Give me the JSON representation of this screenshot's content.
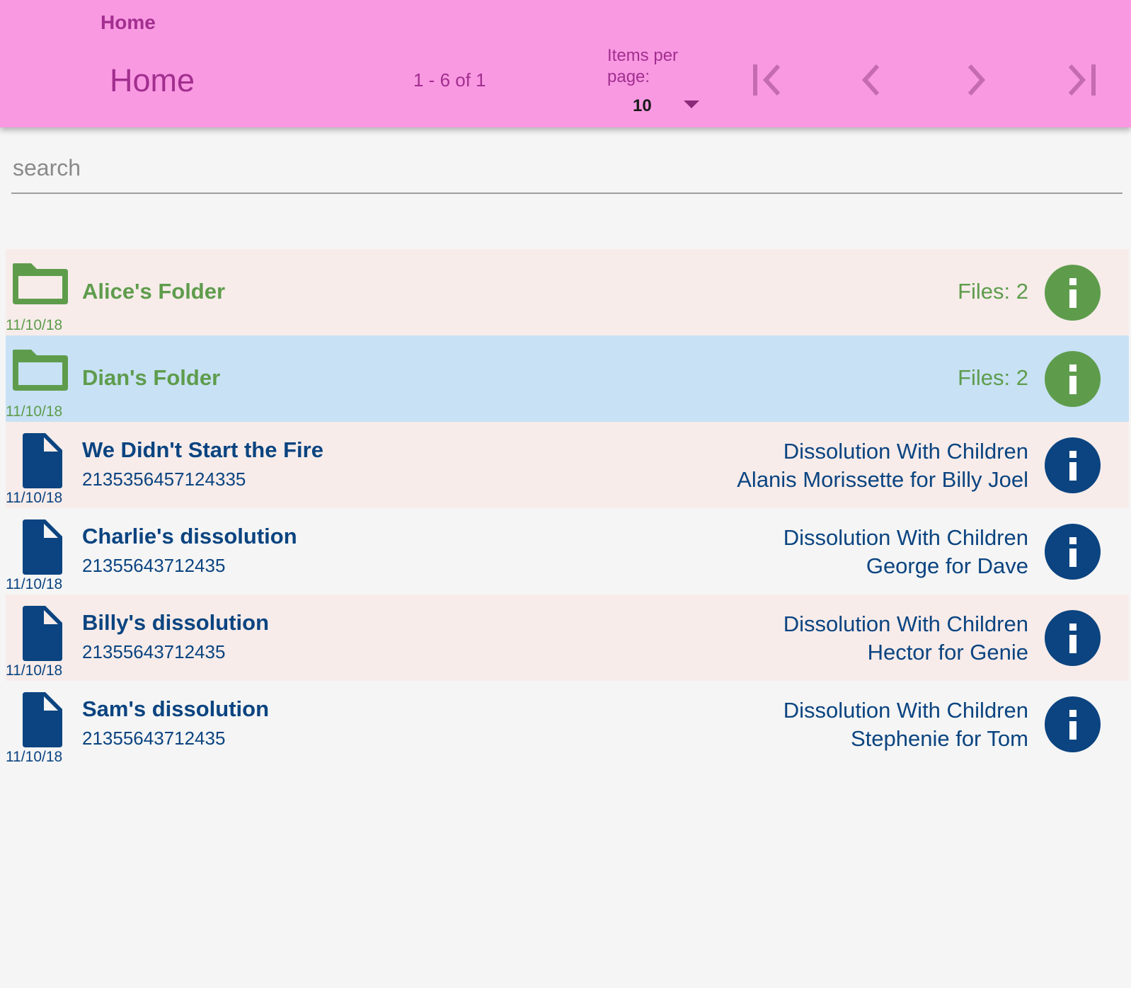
{
  "toolbar": {
    "breadcrumb": "Home",
    "title": "Home",
    "range_label": "1 - 6 of 1",
    "items_per_page_label": "Items per page:",
    "items_per_page_value": "10",
    "colors": {
      "background": "#f999e2",
      "text": "#a22f8f"
    }
  },
  "search": {
    "placeholder": "search",
    "value": ""
  },
  "items": [
    {
      "kind": "folder",
      "title": "Alice's Folder",
      "right_1": "Files: 2",
      "date": "11/10/18",
      "color": "#5e9c4c",
      "icon": "folder-icon"
    },
    {
      "kind": "folder",
      "title": "Dian's Folder",
      "right_1": "Files: 2",
      "date": "11/10/18",
      "color": "#5e9c4c",
      "icon": "folder-icon",
      "selected": true
    },
    {
      "kind": "file",
      "title": "We Didn't Start the Fire",
      "number": "2135356457124335",
      "right_1": "Dissolution With Children",
      "right_2": "Alanis Morissette for Billy Joel",
      "date": "11/10/18",
      "color": "#0b4480",
      "icon": "document-icon"
    },
    {
      "kind": "file",
      "title": "Charlie's dissolution",
      "number": "21355643712435",
      "right_1": "Dissolution With Children",
      "right_2": "George for Dave",
      "date": "11/10/18",
      "color": "#0b4480",
      "icon": "document-icon"
    },
    {
      "kind": "file",
      "title": "Billy's dissolution",
      "number": "21355643712435",
      "right_1": "Dissolution With Children",
      "right_2": "Hector for Genie",
      "date": "11/10/18",
      "color": "#0b4480",
      "icon": "document-icon"
    },
    {
      "kind": "file",
      "title": "Sam's dissolution",
      "number": "21355643712435",
      "right_1": "Dissolution With Children",
      "right_2": "Stephenie for Tom",
      "date": "11/10/18",
      "color": "#0b4480",
      "icon": "document-icon"
    }
  ]
}
